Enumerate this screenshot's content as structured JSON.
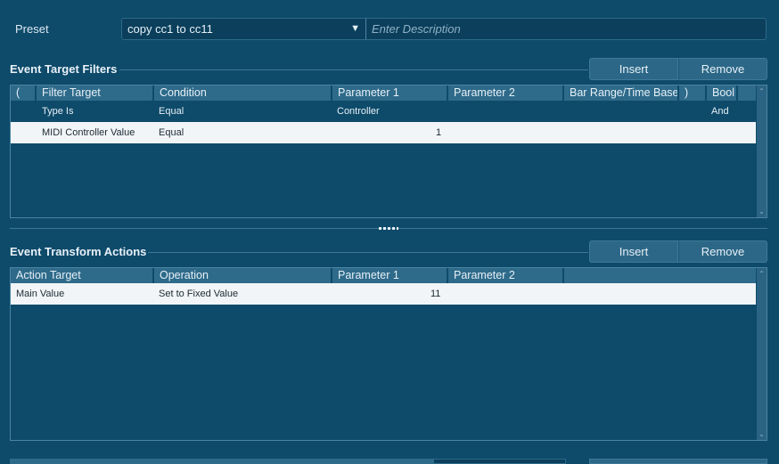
{
  "preset": {
    "label": "Preset",
    "value": "copy cc1 to cc11",
    "description_placeholder": "Enter Description",
    "description_value": ""
  },
  "filters": {
    "title": "Event Target Filters",
    "insert_label": "Insert",
    "remove_label": "Remove",
    "columns": [
      "(",
      "Filter Target",
      "Condition",
      "Parameter 1",
      "Parameter 2",
      "Bar Range/Time Base",
      ")",
      "Bool"
    ],
    "rows": [
      {
        "paren_open": "",
        "target": "Type Is",
        "condition": "Equal",
        "param1": "Controller",
        "param2": "",
        "range": "",
        "paren_close": "",
        "bool": "And",
        "selected": false
      },
      {
        "paren_open": "",
        "target": "MIDI Controller Value",
        "condition": "Equal",
        "param1": "1",
        "param2": "",
        "range": "",
        "paren_close": "",
        "bool": "",
        "selected": true
      }
    ]
  },
  "actions": {
    "title": "Event Transform Actions",
    "insert_label": "Insert",
    "remove_label": "Remove",
    "columns": [
      "Action Target",
      "Operation",
      "Parameter 1",
      "Parameter 2"
    ],
    "rows": [
      {
        "target": "Main Value",
        "operation": "Set to Fixed Value",
        "param1": "11",
        "param2": "",
        "selected": true
      }
    ]
  },
  "colors": {
    "background": "#0e4a6a",
    "header": "#2e6a8a",
    "selected_row": "#f2f5f7",
    "button": "#2c6787"
  }
}
